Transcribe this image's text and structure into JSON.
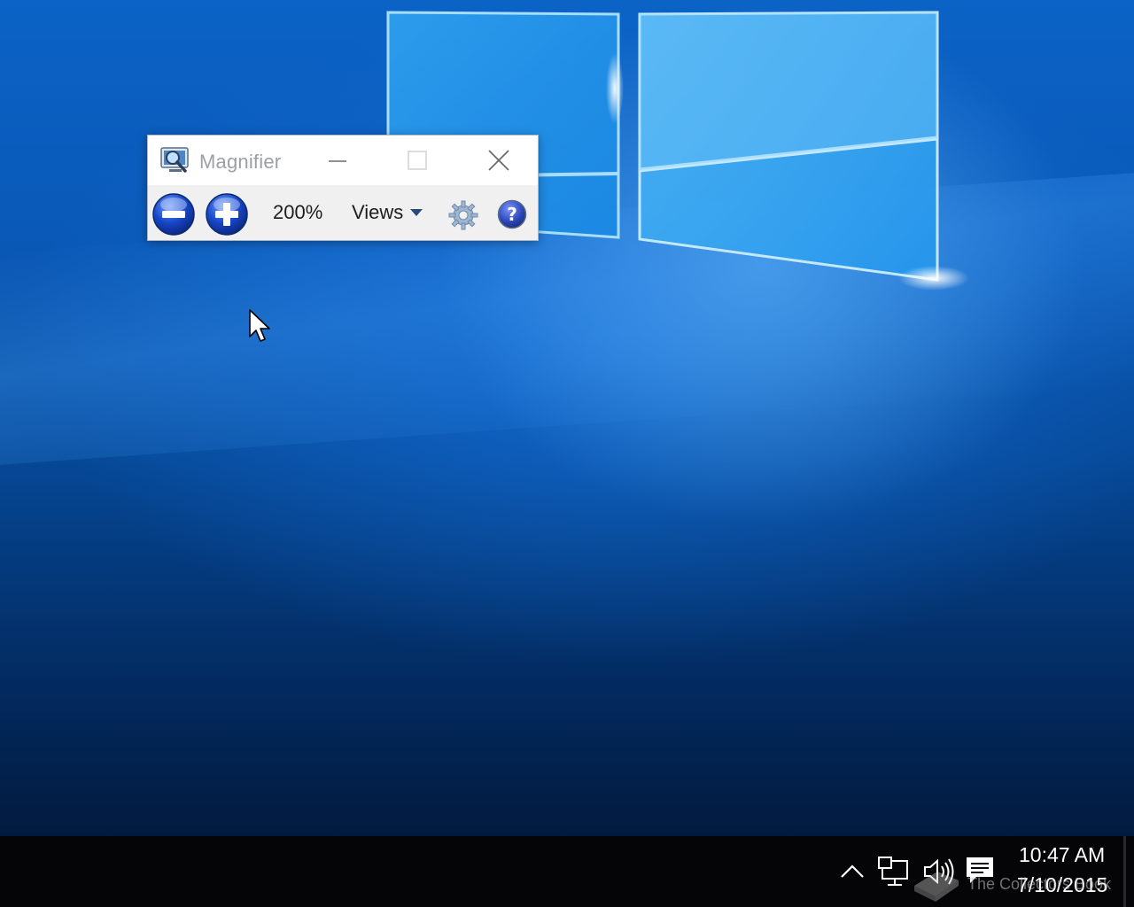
{
  "magnifier": {
    "title": "Magnifier",
    "zoom_level": "200%",
    "views_label": "Views",
    "icons": {
      "app": "magnifier-app-icon",
      "minimize": "minimize-icon",
      "maximize": "maximize-icon",
      "close": "close-icon",
      "zoom_out": "zoom-out-icon",
      "zoom_in": "zoom-in-icon",
      "dropdown": "chevron-down-icon",
      "settings": "gear-icon",
      "help": "help-icon"
    }
  },
  "taskbar": {
    "clock": {
      "time": "10:47 AM",
      "date": "7/10/2015"
    },
    "icons": {
      "show_hidden": "chevron-up-icon",
      "network": "network-icon",
      "volume": "volume-icon",
      "action_center": "action-center-icon"
    }
  },
  "watermark": {
    "text": "The Collectors Book"
  },
  "colors": {
    "taskbar": "#050507",
    "desktop_blue": "#0a58b6",
    "window_bg": "#f0f0f0",
    "button_blue": "#1746c8"
  }
}
